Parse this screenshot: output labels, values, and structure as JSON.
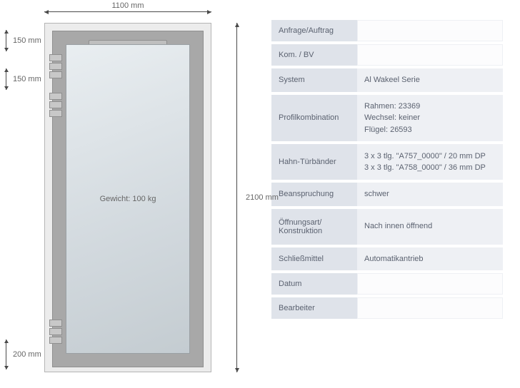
{
  "diagram": {
    "width_label": "1100 mm",
    "height_label": "2100 mm",
    "weight_label": "Gewicht: 100 kg",
    "hinge_dim_top1": "150 mm",
    "hinge_dim_top2": "150 mm",
    "hinge_dim_bottom": "200 mm"
  },
  "spec": {
    "rows": [
      {
        "label": "Anfrage/Auftrag",
        "value": "",
        "blank": true
      },
      {
        "label": "Kom. / BV",
        "value": "",
        "blank": true
      },
      {
        "label": "System",
        "value": "Al Wakeel Serie"
      },
      {
        "label": "Profilkombination",
        "lines": [
          "Rahmen: 23369",
          "Wechsel: keiner",
          "Flügel: 26593"
        ],
        "tall": true
      },
      {
        "label": "Hahn-Türbänder",
        "lines": [
          "3 x 3 tlg. \"A757_0000\" / 20 mm DP",
          "3 x 3 tlg. \"A758_0000\" / 36 mm DP"
        ],
        "tall2": true
      },
      {
        "label": "Beanspruchung",
        "value": "schwer"
      },
      {
        "label": "Öffnungsart/ Konstruktion",
        "value": "Nach innen öffnend",
        "tall2": true
      },
      {
        "label": "Schließmittel",
        "value": "Automatikantrieb"
      },
      {
        "label": "Datum",
        "value": "",
        "blank": true
      },
      {
        "label": "Bearbeiter",
        "value": "",
        "blank": true
      }
    ]
  }
}
